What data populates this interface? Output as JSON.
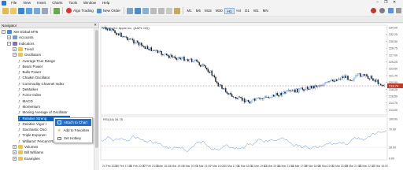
{
  "menu": {
    "items": [
      "File",
      "View",
      "Insert",
      "Charts",
      "Tools",
      "Window",
      "Help"
    ]
  },
  "toolbar": {
    "algo_label": "Algo Trading",
    "new_order_label": "New Order",
    "timeframes": [
      "M1",
      "M5",
      "M15",
      "M30",
      "H1",
      "H4",
      "D1",
      "W1",
      "MN"
    ],
    "active_timeframe": "H1"
  },
  "navigator": {
    "title": "Navigator",
    "items": [
      {
        "label": "XM Global MT5",
        "level": 0,
        "expander": "−",
        "icon": "terminal-icon"
      },
      {
        "label": "Accounts",
        "level": 1,
        "expander": "+",
        "icon": "accounts-icon"
      },
      {
        "label": "Indicators",
        "level": 1,
        "expander": "−",
        "icon": "indicators-icon"
      },
      {
        "label": "Trend",
        "level": 2,
        "expander": "+",
        "icon": "folder-icon"
      },
      {
        "label": "Oscillators",
        "level": 2,
        "expander": "−",
        "icon": "folder-icon"
      },
      {
        "label": "Average True Range",
        "level": 3,
        "icon": "indicator-icon"
      },
      {
        "label": "Bears Power",
        "level": 3,
        "icon": "indicator-icon"
      },
      {
        "label": "Bulls Power",
        "level": 3,
        "icon": "indicator-icon"
      },
      {
        "label": "Chaikin Oscillator",
        "level": 3,
        "icon": "indicator-icon"
      },
      {
        "label": "Commodity Channel Index",
        "level": 3,
        "icon": "indicator-icon"
      },
      {
        "label": "DeMarker",
        "level": 3,
        "icon": "indicator-icon"
      },
      {
        "label": "Force Index",
        "level": 3,
        "icon": "indicator-icon"
      },
      {
        "label": "MACD",
        "level": 3,
        "icon": "indicator-icon"
      },
      {
        "label": "Momentum",
        "level": 3,
        "icon": "indicator-icon"
      },
      {
        "label": "Moving Average of Oscillator",
        "level": 3,
        "icon": "indicator-icon"
      },
      {
        "label": "Relative Streng",
        "level": 3,
        "icon": "indicator-icon",
        "selected": true
      },
      {
        "label": "Relative Vigor I",
        "level": 3,
        "icon": "indicator-icon"
      },
      {
        "label": "Stochastic Osci",
        "level": 3,
        "icon": "indicator-icon"
      },
      {
        "label": "Triple Exponen",
        "level": 3,
        "icon": "indicator-icon"
      },
      {
        "label": "Williams' Percent Range",
        "level": 3,
        "icon": "indicator-icon"
      },
      {
        "label": "Volumes",
        "level": 2,
        "expander": "+",
        "icon": "folder-icon"
      },
      {
        "label": "Bill Williams",
        "level": 2,
        "expander": "+",
        "icon": "folder-icon"
      },
      {
        "label": "Examples",
        "level": 2,
        "expander": "+",
        "icon": "folder-icon"
      }
    ]
  },
  "context_menu": {
    "items": [
      {
        "label": "Attach to Chart",
        "highlighted": true,
        "icon": "attach-icon"
      },
      {
        "label": "Add to Favorites",
        "highlighted": false,
        "icon": "star-icon"
      },
      {
        "label": "Set Hotkey",
        "highlighted": false,
        "icon": "hotkey-icon"
      }
    ]
  },
  "chart": {
    "header_text": "Apple, H1: Apple Inc. (AAPL.OQ)",
    "rsi_label": "RSI(14) 34.78",
    "price_axis": [
      "234.00",
      "232.25",
      "230.50",
      "228.75",
      "227.00",
      "225.25",
      "223.50",
      "221.75",
      "220.00",
      "218.25",
      "216.50",
      "214.75",
      "213.00"
    ],
    "rsi_axis": [
      "100.00",
      "70.00",
      "30.00",
      "0.00"
    ],
    "time_axis": [
      "24 Feb 2025",
      "25 Feb 17:00",
      "26 Feb 20:00",
      "27 Feb 23:00",
      "3 Mar 18:00",
      "4 Mar 19:00",
      "5 Mar 20:00",
      "6 Mar 21:00",
      "7 Mar 16:00",
      "10 Mar 17:00",
      "11 Mar 18:00",
      "12 Mar 19:00",
      "13 Mar 20:00",
      "14 Mar 21:00",
      "18 Mar 17:00",
      "19 Mar 18:00",
      "20 Mar 19:00",
      "21 Mar 20:00",
      "24 Mar 21:00",
      "25 Mar 22:00",
      "27 Mar 16:00"
    ],
    "current_price": "218.74",
    "colors": {
      "bull": "#2a7bde",
      "bear": "#1b1b1b",
      "rsi_line": "#5a8fd6",
      "last_price": "#c0392b"
    }
  }
}
